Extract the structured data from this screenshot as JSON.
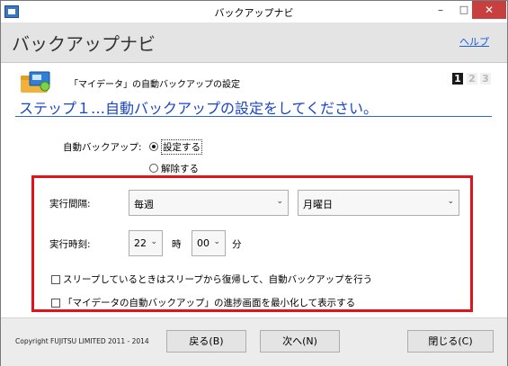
{
  "window": {
    "title": "バックアップナビ",
    "minimize_glyph": "–",
    "maximize_glyph": "□",
    "close_glyph": "✕"
  },
  "header": {
    "app_name": "バックアップナビ",
    "help_label": "ヘルプ"
  },
  "step": {
    "caption": "「マイデータ」の自動バックアップの設定",
    "indicators": [
      "1",
      "2",
      "3"
    ],
    "current": 1,
    "heading": "ステップ１…自動バックアップの設定をしてください。"
  },
  "auto_backup": {
    "label": "自動バックアップ:",
    "options": [
      "設定する",
      "解除する"
    ],
    "selected": "設定する"
  },
  "schedule": {
    "interval_label": "実行間隔:",
    "interval_value": "毎週",
    "day_value": "月曜日",
    "time_label": "実行時刻:",
    "hour_value": "22",
    "hour_unit": "時",
    "minute_value": "00",
    "minute_unit": "分",
    "checkbox_sleep": "スリープしているときはスリープから復帰して、自動バックアップを行う",
    "checkbox_minimize": "「マイデータの自動バックアップ」の進捗画面を最小化して表示する"
  },
  "footer": {
    "copyright": "Copyright FUJITSU LIMITED 2011 - 2014",
    "back_label": "戻る(B)",
    "next_label": "次へ(N)",
    "close_label": "閉じる(C)"
  },
  "colors": {
    "accent_blue": "#1a44c8",
    "highlight_red": "#e0141b",
    "close_red": "#c7403f"
  }
}
